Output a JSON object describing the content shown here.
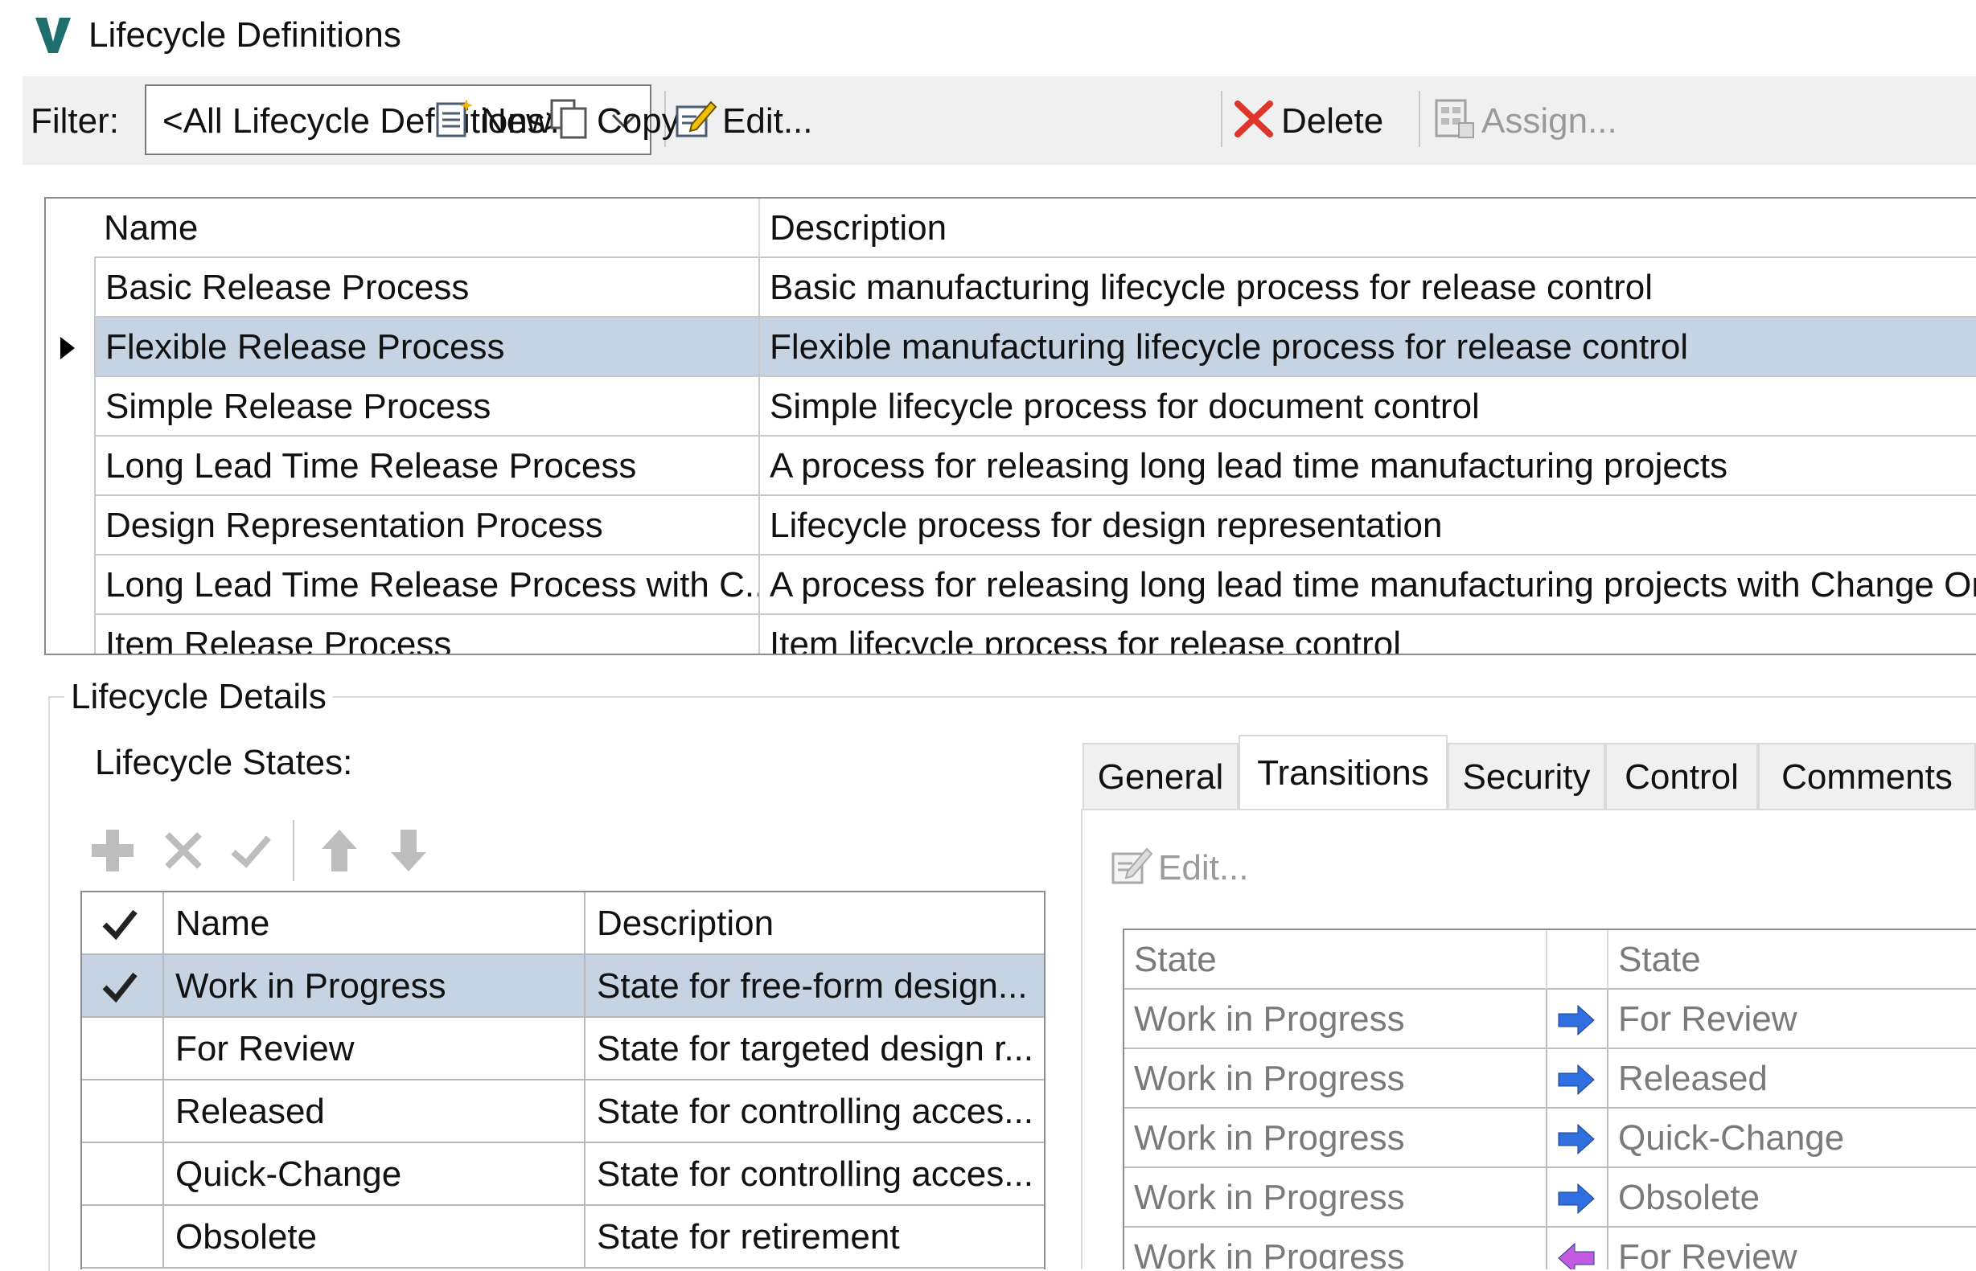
{
  "window": {
    "title": "Lifecycle Definitions",
    "logo_letter": "V"
  },
  "toolbar": {
    "filter_label": "Filter:",
    "filter_value": "<All Lifecycle Definitions>",
    "new_label": "New...",
    "copy_label": "Copy...",
    "edit_label": "Edit...",
    "delete_label": "Delete",
    "assign_label": "Assign..."
  },
  "definitions": {
    "columns": [
      "Name",
      "Description"
    ],
    "rows": [
      {
        "name": "Basic Release Process",
        "description": "Basic manufacturing lifecycle process for release control"
      },
      {
        "name": "Flexible Release Process",
        "description": "Flexible manufacturing lifecycle process for release control",
        "selected": true
      },
      {
        "name": "Simple Release Process",
        "description": "Simple lifecycle process for document control"
      },
      {
        "name": "Long Lead Time Release Process",
        "description": "A process for releasing long lead time manufacturing projects"
      },
      {
        "name": "Design Representation Process",
        "description": "Lifecycle process for design representation"
      },
      {
        "name": "Long Lead Time Release Process with C...",
        "description": "A process for releasing long lead time manufacturing projects with Change Orders"
      },
      {
        "name": "Item Release Process",
        "description": "Item lifecycle process for release control"
      }
    ]
  },
  "details": {
    "group_label": "Lifecycle Details",
    "states_label": "Lifecycle States:",
    "states": {
      "columns": [
        "Name",
        "Description"
      ],
      "rows": [
        {
          "name": "Work in Progress",
          "description": "State for free-form design...",
          "default": true,
          "selected": true
        },
        {
          "name": "For Review",
          "description": "State for targeted design r..."
        },
        {
          "name": "Released",
          "description": "State for controlling acces..."
        },
        {
          "name": "Quick-Change",
          "description": "State for controlling acces..."
        },
        {
          "name": "Obsolete",
          "description": "State for retirement"
        }
      ]
    },
    "tabs": [
      "General",
      "Transitions",
      "Security",
      "Control",
      "Comments"
    ],
    "active_tab": "Transitions",
    "transitions": {
      "edit_label": "Edit...",
      "columns": [
        "State",
        "State"
      ],
      "rows": [
        {
          "from": "Work in Progress",
          "to": "For Review",
          "direction": "forward"
        },
        {
          "from": "Work in Progress",
          "to": "Released",
          "direction": "forward"
        },
        {
          "from": "Work in Progress",
          "to": "Quick-Change",
          "direction": "forward"
        },
        {
          "from": "Work in Progress",
          "to": "Obsolete",
          "direction": "forward"
        },
        {
          "from": "Work in Progress",
          "to": "For Review",
          "direction": "backward"
        }
      ]
    }
  },
  "colors": {
    "selection": "#c5d3e2",
    "logo": "#1f6e6e",
    "forward_arrow": "#2f6fe0",
    "backward_arrow": "#c45ae0",
    "delete_x": "#e0352b"
  }
}
